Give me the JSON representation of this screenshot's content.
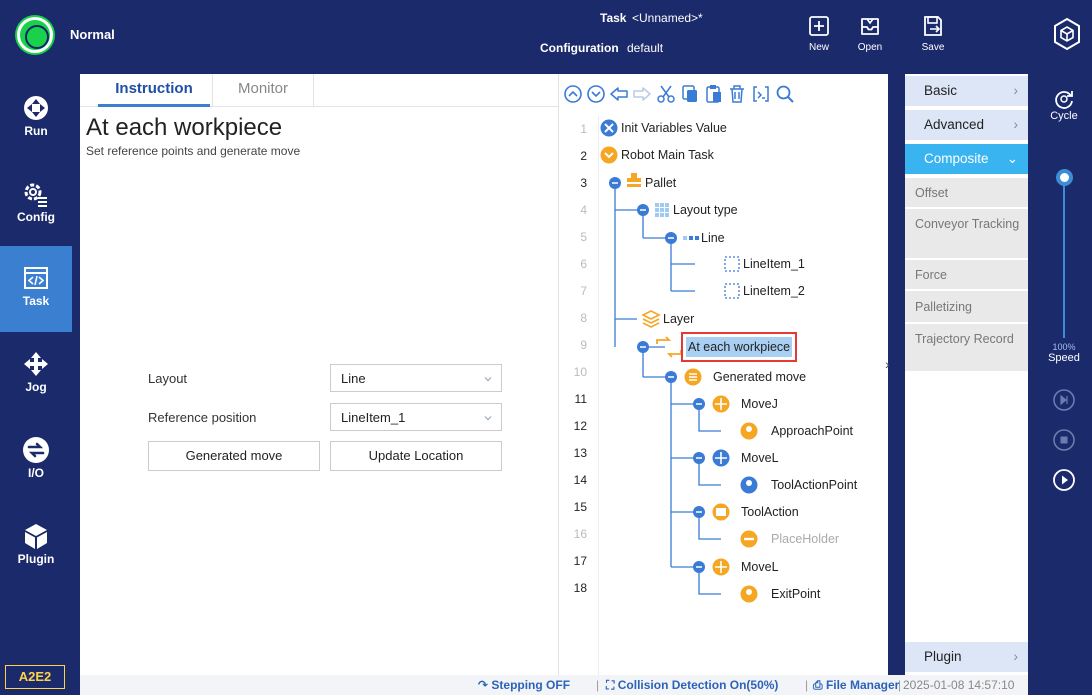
{
  "topbar": {
    "status_text": "Normal",
    "task_label": "Task",
    "task_value": "<Unnamed>*",
    "config_label": "Configuration",
    "config_value": "default",
    "new_label": "New",
    "open_label": "Open",
    "save_label": "Save",
    "status_color": "#19d14a"
  },
  "nav": {
    "items": [
      {
        "label": "Run",
        "icon": "run-icon"
      },
      {
        "label": "Config",
        "icon": "gear-icon"
      },
      {
        "label": "Task",
        "icon": "code-icon",
        "active": true
      },
      {
        "label": "Jog",
        "icon": "move-arrows-icon"
      },
      {
        "label": "I/O",
        "icon": "io-icon"
      },
      {
        "label": "Plugin",
        "icon": "cube-icon"
      }
    ],
    "badge": "A2E2"
  },
  "left": {
    "tab_instruction": "Instruction",
    "tab_monitor": "Monitor",
    "title": "At each workpiece",
    "subtitle": "Set reference points and generate move",
    "layout_label": "Layout",
    "layout_value": "Line",
    "ref_label": "Reference position",
    "ref_value": "LineItem_1",
    "gen_button": "Generated move",
    "update_button": "Update Location"
  },
  "tree": {
    "line_numbers": [
      "1",
      "2",
      "3",
      "4",
      "5",
      "6",
      "7",
      "8",
      "9",
      "10",
      "11",
      "12",
      "13",
      "14",
      "15",
      "16",
      "17",
      "18"
    ],
    "nodes": [
      {
        "label": "Init Variables Value"
      },
      {
        "label": "Robot Main Task"
      },
      {
        "label": "Pallet"
      },
      {
        "label": "Layout type"
      },
      {
        "label": "Line"
      },
      {
        "label": "LineItem_1"
      },
      {
        "label": "LineItem_2"
      },
      {
        "label": "Layer"
      },
      {
        "label": "At each workpiece",
        "selected": true
      },
      {
        "label": "Generated move"
      },
      {
        "label": "MoveJ"
      },
      {
        "label": "ApproachPoint"
      },
      {
        "label": "MoveL"
      },
      {
        "label": "ToolActionPoint"
      },
      {
        "label": "ToolAction"
      },
      {
        "label": "PlaceHolder",
        "dim": true
      },
      {
        "label": "MoveL"
      },
      {
        "label": "ExitPoint"
      }
    ]
  },
  "categories": {
    "basic": "Basic",
    "advanced": "Advanced",
    "composite": "Composite",
    "subitems": [
      "Offset",
      "Conveyor Tracking",
      "Force",
      "Palletizing",
      "Trajectory Record"
    ],
    "plugin": "Plugin"
  },
  "rightbar": {
    "cycle_label": "Cycle",
    "speed_value": "100%",
    "speed_label": "Speed",
    "speed_fraction": 1.0
  },
  "statusbar": {
    "stepping": "Stepping OFF",
    "collision": "Collision Detection On(50%)",
    "file_manager": "File Manager",
    "datetime": "2025-01-08 14:57:10"
  }
}
